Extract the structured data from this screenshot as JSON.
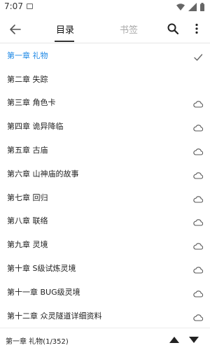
{
  "status_bar": {
    "time": "7:07",
    "icons": [
      "notification-icon",
      "wifi-icon",
      "signal-icon",
      "battery-icon"
    ]
  },
  "app_bar": {
    "back_icon": "arrow-left-icon",
    "tabs": [
      {
        "label": "目录",
        "active": true
      },
      {
        "label": "书签",
        "active": false
      }
    ],
    "search_icon": "search-icon",
    "more_icon": "more-vert-icon"
  },
  "chapters": [
    {
      "title": "第一章 礼物",
      "status": "check",
      "current": true
    },
    {
      "title": "第二章 失踪",
      "status": "none",
      "current": false
    },
    {
      "title": "第三章 角色卡",
      "status": "cloud",
      "current": false
    },
    {
      "title": "第四章 诡异降临",
      "status": "cloud",
      "current": false
    },
    {
      "title": "第五章 古庙",
      "status": "cloud",
      "current": false
    },
    {
      "title": "第六章 山神庙的故事",
      "status": "cloud",
      "current": false
    },
    {
      "title": "第七章 回归",
      "status": "cloud",
      "current": false
    },
    {
      "title": "第八章 联络",
      "status": "cloud",
      "current": false
    },
    {
      "title": "第九章 灵境",
      "status": "cloud",
      "current": false
    },
    {
      "title": "第十章 S级试炼灵境",
      "status": "cloud",
      "current": false
    },
    {
      "title": "第十一章 BUG级灵境",
      "status": "cloud",
      "current": false
    },
    {
      "title": "第十二章 众灵隧道详细资料",
      "status": "cloud",
      "current": false
    }
  ],
  "footer": {
    "progress": "第一章 礼物(1/352)",
    "up_icon": "triangle-up-icon",
    "down_icon": "triangle-down-icon"
  },
  "colors": {
    "accent": "#1e88e5",
    "text": "#222222",
    "muted": "#aaaaaa",
    "icon": "#555555"
  }
}
